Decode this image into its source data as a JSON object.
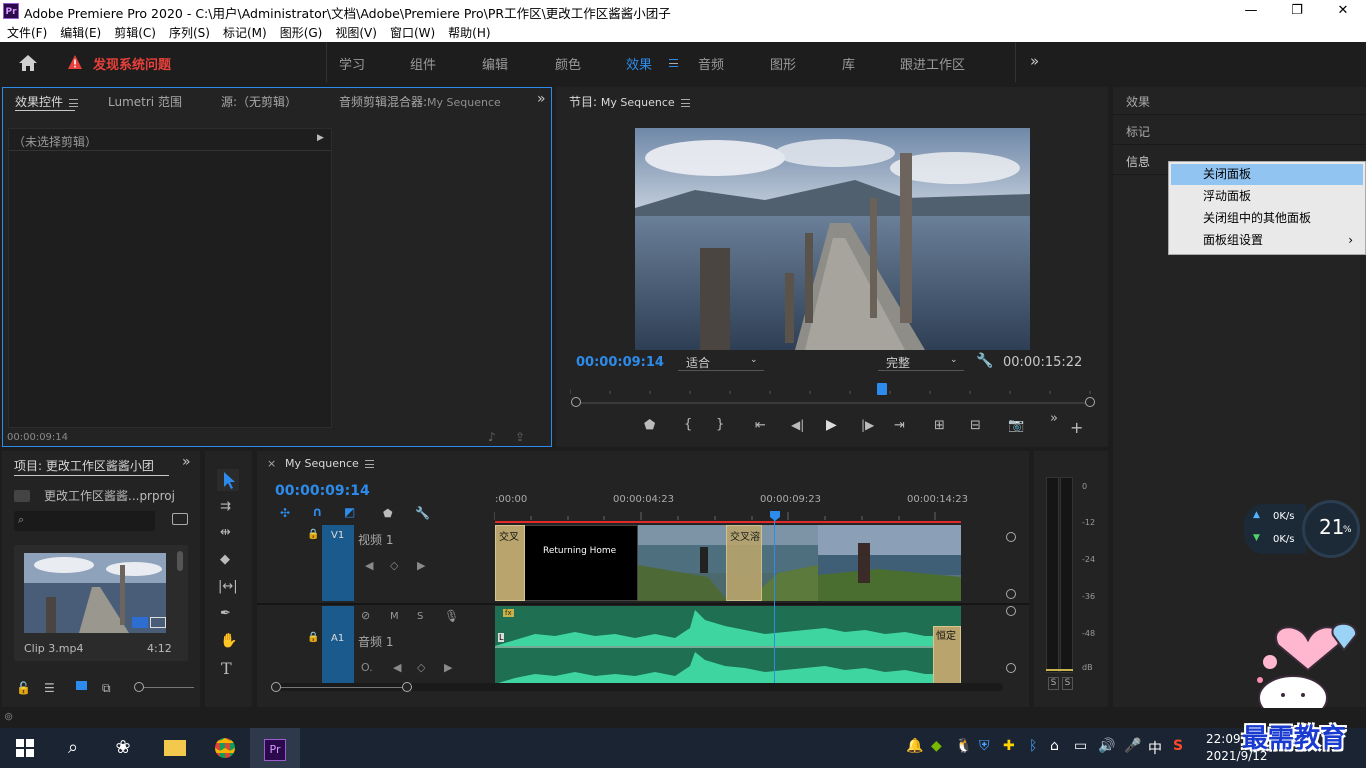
{
  "title_bar": {
    "app_icon": "Pr",
    "title": "Adobe Premiere Pro 2020 - C:\\用户\\Administrator\\文档\\Adobe\\Premiere Pro\\PR工作区\\更改工作区酱酱小团子",
    "minimize": "—",
    "maximize": "❐",
    "close": "✕"
  },
  "menu": [
    "文件(F)",
    "编辑(E)",
    "剪辑(C)",
    "序列(S)",
    "标记(M)",
    "图形(G)",
    "视图(V)",
    "窗口(W)",
    "帮助(H)"
  ],
  "workspace_bar": {
    "home_icon": "home-icon",
    "warning": "发现系统问题",
    "tabs": [
      "学习",
      "组件",
      "编辑",
      "颜色",
      "效果",
      "音频",
      "图形",
      "库",
      "跟进工作区"
    ],
    "active_tab": "效果",
    "more": "»"
  },
  "source_panel": {
    "tabs": [
      "效果控件",
      "Lumetri 范围",
      "源:（无剪辑）",
      "音频剪辑混合器:"
    ],
    "mixer_sequence": "My Sequence",
    "more": "»",
    "no_clip": "（未选择剪辑）",
    "timecode": "00:00:09:14"
  },
  "program_monitor": {
    "title": "节目:",
    "sequence": "My Sequence",
    "timecode": "00:00:09:14",
    "fit": "适合",
    "quality": "完整",
    "duration": "00:00:15:22",
    "more": "»",
    "add": "+"
  },
  "right_panels": {
    "items": [
      "效果",
      "标记",
      "信息"
    ]
  },
  "context_menu": {
    "items": [
      "关闭面板",
      "浮动面板",
      "关闭组中的其他面板",
      "面板组设置"
    ],
    "submenu_arrow": "›",
    "highlighted_index": 0
  },
  "project_panel": {
    "title": "项目: 更改工作区酱酱小团",
    "file": "更改工作区酱酱...prproj",
    "search_placeholder": "",
    "clip_name": "Clip 3.mp4",
    "clip_duration": "4:12",
    "more": "»"
  },
  "timeline": {
    "close": "×",
    "sequence": "My Sequence",
    "timecode": "00:00:09:14",
    "ruler": [
      ":00:00",
      "00:00:04:23",
      "00:00:09:23",
      "00:00:14:23"
    ],
    "playhead_fraction": 0.601,
    "video_track": {
      "id": "V1",
      "name": "视频 1"
    },
    "audio_track": {
      "id": "A1",
      "name": "音频 1",
      "m": "M",
      "s": "S"
    },
    "clips": {
      "transition1": "交叉",
      "title_clip": "Returning Home",
      "transition2": "交叉溶",
      "audio_fx": "fx",
      "audio_label": "恒定",
      "channel_l": "L"
    }
  },
  "meter": {
    "scale": [
      "0",
      "-12",
      "-24",
      "-36",
      "-48",
      "dB"
    ],
    "solo": [
      "S",
      "S"
    ]
  },
  "net_widget": {
    "up": "0K/s",
    "down": "0K/s",
    "percent": "21",
    "pct_sign": "%"
  },
  "taskbar": {
    "time": "22:09",
    "date": "2021/9/12",
    "ime": "中",
    "watermark": "最需教育"
  },
  "colors": {
    "accent": "#2d8ceb",
    "warning": "#e8403a",
    "audio_clip": "#2fa37a",
    "track_header": "#1a5a8c",
    "menu_highlight": "#92c4f2"
  }
}
